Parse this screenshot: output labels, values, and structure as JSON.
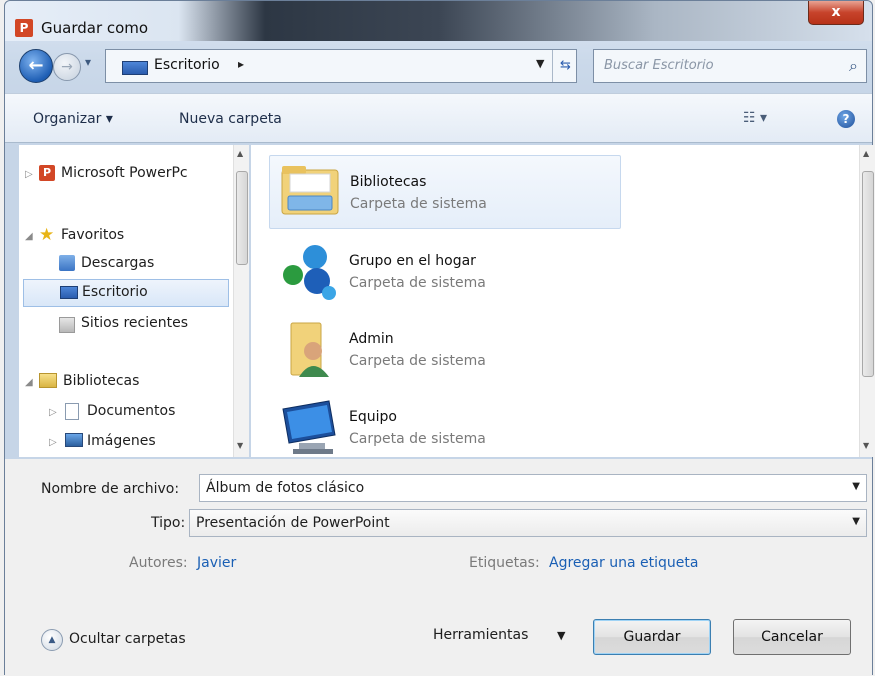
{
  "window": {
    "title": "Guardar como",
    "app_icon_letter": "P",
    "close_glyph": "x"
  },
  "nav": {
    "back_glyph": "←",
    "forward_glyph": "→",
    "address": {
      "icon": "desktop-icon",
      "path": "Escritorio",
      "separator": "▸"
    },
    "search_placeholder": "Buscar Escritorio"
  },
  "toolbar": {
    "organize": "Organizar ▾",
    "new_folder": "Nueva carpeta",
    "views_glyph": "☷ ▾",
    "help_glyph": "?"
  },
  "sidebar": {
    "items": [
      {
        "label": "Microsoft PowerPc",
        "icon": "powerpoint-icon",
        "expander": "▷"
      },
      {
        "label": "Favoritos",
        "icon": "star-icon",
        "expander": "◢"
      },
      {
        "label": "Descargas",
        "icon": "downloads-icon"
      },
      {
        "label": "Escritorio",
        "icon": "desktop-icon",
        "selected": true
      },
      {
        "label": "Sitios recientes",
        "icon": "recent-places-icon"
      },
      {
        "label": "Bibliotecas",
        "icon": "libraries-icon",
        "expander": "◢"
      },
      {
        "label": "Documentos",
        "icon": "documents-icon",
        "expander": "▷"
      },
      {
        "label": "Imágenes",
        "icon": "pictures-icon",
        "expander": "▷"
      }
    ]
  },
  "files": {
    "items": [
      {
        "name": "Bibliotecas",
        "type": "Carpeta de sistema",
        "icon": "libraries-folder-icon",
        "highlighted": true
      },
      {
        "name": "Grupo en el hogar",
        "type": "Carpeta de sistema",
        "icon": "homegroup-icon"
      },
      {
        "name": "Admin",
        "type": "Carpeta de sistema",
        "icon": "user-folder-icon"
      },
      {
        "name": "Equipo",
        "type": "Carpeta de sistema",
        "icon": "computer-icon"
      }
    ]
  },
  "form": {
    "filename_label": "Nombre de archivo:",
    "filename_value": "Álbum de fotos clásico",
    "type_label": "Tipo:",
    "type_value": "Presentación de PowerPoint",
    "authors_label": "Autores:",
    "authors_value": "Javier",
    "tags_label": "Etiquetas:",
    "tags_value": "Agregar una etiqueta"
  },
  "footer": {
    "hide_folders": "Ocultar carpetas",
    "tools": "Herramientas",
    "tools_arrow": "▼",
    "save": "Guardar",
    "cancel": "Cancelar"
  },
  "colors": {
    "accent_blue": "#1a5fb4",
    "close_red": "#c7432b",
    "selection": "#d9e7f8"
  }
}
